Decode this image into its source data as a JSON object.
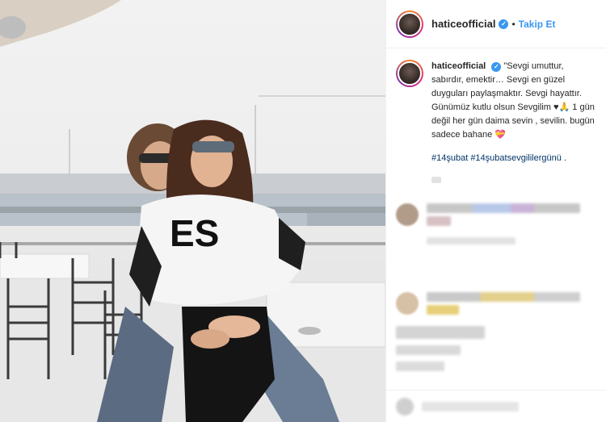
{
  "post": {
    "username": "haticeofficial",
    "verified_badge": "✓",
    "separator": "•",
    "follow_label": "Takip Et",
    "caption_text": "\"Sevgi umuttur, sabırdır, emektir… Sevgi en güzel duyguları paylaşmaktır. Sevgi hayattır. Günümüz kutlu olsun Sevgilim ♥🙏 1 gün değil her gün daima sevin , sevilin. bugün sadece bahane 💝",
    "hashtags": "#14şubat #14şubatsevgililergünü ."
  },
  "icons": {
    "verified": "verified-badge-icon",
    "avatar": "profile-avatar"
  },
  "colors": {
    "link_blue": "#3897f0",
    "hashtag_blue": "#003569",
    "text": "#262626",
    "border": "#efefef"
  }
}
